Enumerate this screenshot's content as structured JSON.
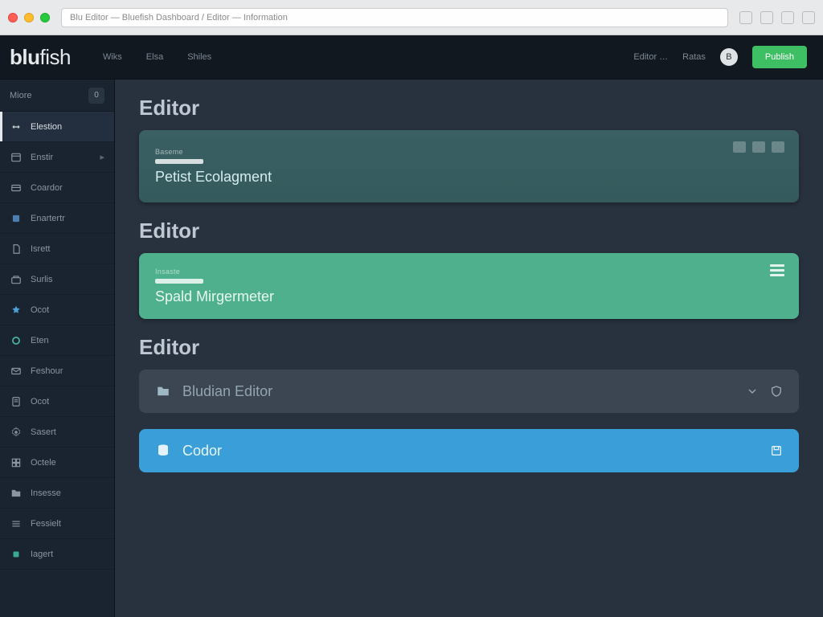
{
  "browser": {
    "url": "Blu Editor — Bluefish Dashboard / Editor — Information"
  },
  "header": {
    "logo_a": "blu",
    "logo_b": "fish",
    "nav": [
      "Wiks",
      "Elsa",
      "Shiles"
    ],
    "right_links": [
      "Editor …",
      "Ratas"
    ],
    "avatar_initial": "B",
    "cta": "Publish"
  },
  "sidebar": {
    "header": "Miore",
    "header_badge": "0",
    "items": [
      {
        "label": "Elestion",
        "active": true,
        "icon": "arrows"
      },
      {
        "label": "Enstir",
        "active": false,
        "icon": "panel",
        "trail": true
      },
      {
        "label": "Coardor",
        "active": false,
        "icon": "card"
      },
      {
        "label": "Enartertr",
        "active": false,
        "icon": "box"
      },
      {
        "label": "Isrett",
        "active": false,
        "icon": "doc"
      },
      {
        "label": "Surlis",
        "active": false,
        "icon": "tray"
      },
      {
        "label": "Ocot",
        "active": false,
        "icon": "star"
      },
      {
        "label": "Eten",
        "active": false,
        "icon": "ring"
      },
      {
        "label": "Feshour",
        "active": false,
        "icon": "mail"
      },
      {
        "label": "Ocot",
        "active": false,
        "icon": "page"
      },
      {
        "label": "Sasert",
        "active": false,
        "icon": "gear"
      },
      {
        "label": "Octele",
        "active": false,
        "icon": "grid"
      },
      {
        "label": "Insesse",
        "active": false,
        "icon": "folder"
      },
      {
        "label": "Fessielt",
        "active": false,
        "icon": "lines"
      },
      {
        "label": "Iagert",
        "active": false,
        "icon": "chip"
      }
    ]
  },
  "main": {
    "sections": [
      {
        "heading": "Editor"
      },
      {
        "heading": "Editor"
      },
      {
        "heading": "Editor"
      }
    ],
    "card_teal": {
      "meta": "Baseme",
      "title": "Petist Ecolagment"
    },
    "card_green": {
      "meta": "Insaste",
      "title": "Spald Mirgermeter"
    },
    "row_dark": {
      "title": "Bludian Editor"
    },
    "row_blue": {
      "title": "Codor"
    }
  }
}
